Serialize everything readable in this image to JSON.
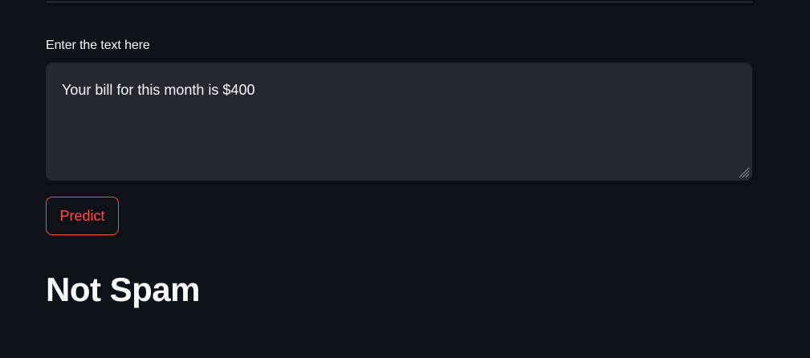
{
  "form": {
    "label": "Enter the text here",
    "text_value": "Your bill for this month is $400",
    "predict_label": "Predict"
  },
  "result": {
    "text": "Not Spam"
  },
  "colors": {
    "background": "#0e1117",
    "input_background": "#262730",
    "accent": "#ff4b4b",
    "text": "#fafafa"
  },
  "icons": {
    "resize_handle": "resize-grip-icon"
  }
}
